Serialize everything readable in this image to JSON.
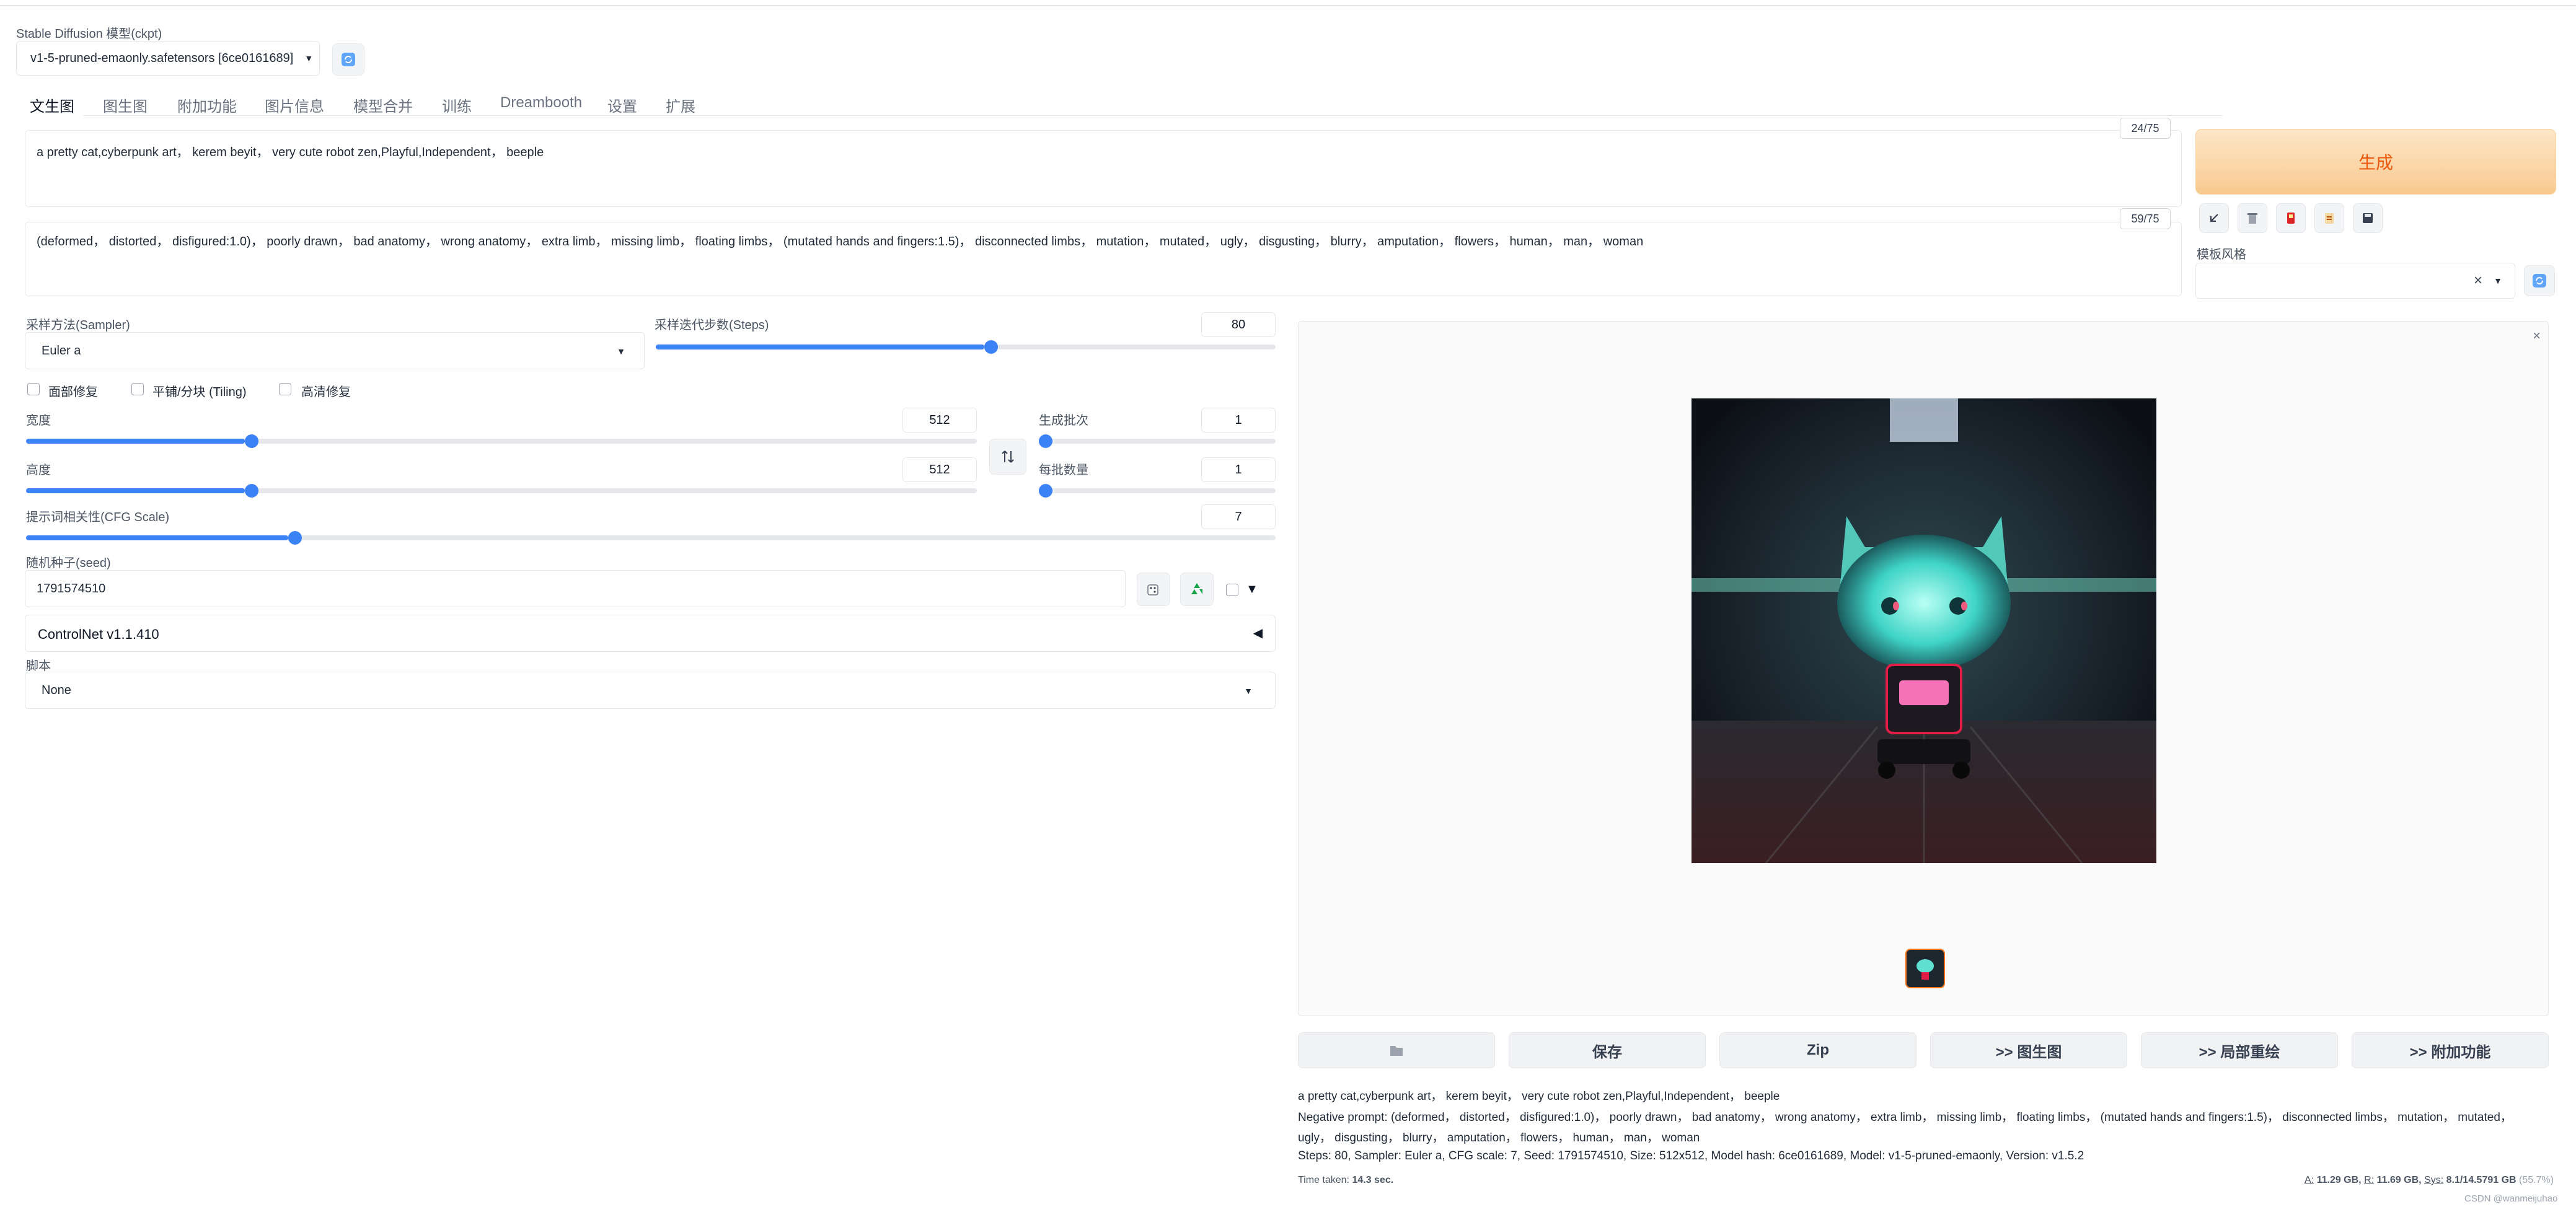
{
  "model": {
    "label": "Stable Diffusion 模型(ckpt)",
    "selected": "v1-5-pruned-emaonly.safetensors [6ce0161689]"
  },
  "tabs": [
    {
      "label": "文生图",
      "active": true
    },
    {
      "label": "图生图"
    },
    {
      "label": "附加功能"
    },
    {
      "label": "图片信息"
    },
    {
      "label": "模型合并"
    },
    {
      "label": "训练"
    },
    {
      "label": "Dreambooth"
    },
    {
      "label": "设置"
    },
    {
      "label": "扩展"
    }
  ],
  "prompt": {
    "value": "a pretty cat,cyberpunk art， kerem beyit， very cute robot zen,Playful,Independent， beeple",
    "counter": "24/75"
  },
  "negative_prompt": {
    "value": "(deformed， distorted， disfigured:1.0)， poorly drawn， bad anatomy， wrong anatomy， extra limb， missing limb， floating limbs， (mutated hands and fingers:1.5)， disconnected limbs， mutation， mutated， ugly， disgusting， blurry， amputation， flowers， human， man， woman",
    "counter": "59/75"
  },
  "generate_label": "生成",
  "style": {
    "label": "模板风格",
    "clear": "×"
  },
  "sampler": {
    "label": "采样方法(Sampler)",
    "value": "Euler a"
  },
  "steps": {
    "label": "采样迭代步数(Steps)",
    "value": "80",
    "fraction": 0.53
  },
  "checkboxes": [
    "面部修复",
    "平铺/分块 (Tiling)",
    "高清修复"
  ],
  "width": {
    "label": "宽度",
    "value": "512",
    "fraction": 0.23
  },
  "height": {
    "label": "高度",
    "value": "512",
    "fraction": 0.23
  },
  "batch_count": {
    "label": "生成批次",
    "value": "1",
    "fraction": 0.0
  },
  "batch_size": {
    "label": "每批数量",
    "value": "1",
    "fraction": 0.0
  },
  "cfg": {
    "label": "提示词相关性(CFG Scale)",
    "value": "7",
    "fraction": 0.21
  },
  "seed": {
    "label": "随机种子(seed)",
    "value": "1791574510",
    "extra": "▼"
  },
  "controlnet": {
    "label": "ControlNet v1.1.410",
    "arrow": "◀"
  },
  "script": {
    "label": "脚本",
    "value": "None"
  },
  "output_buttons": {
    "save": "保存",
    "zip": "Zip",
    "to_img2img": ">> 图生图",
    "to_inpaint": ">> 局部重绘",
    "to_extras": ">> 附加功能"
  },
  "gen_info": {
    "prompt": "a pretty cat,cyberpunk art， kerem beyit， very cute robot zen,Playful,Independent， beeple",
    "negative_1": "Negative prompt: (deformed， distorted， disfigured:1.0)， poorly drawn， bad anatomy， wrong anatomy， extra limb， missing limb， floating limbs， (mutated hands and fingers:1.5)， disconnected limbs， mutation， mutated，",
    "negative_2": "ugly， disgusting， blurry， amputation， flowers， human， man， woman",
    "params": "Steps: 80, Sampler: Euler a, CFG scale: 7, Seed: 1791574510, Size: 512x512, Model hash: 6ce0161689, Model: v1-5-pruned-emaonly, Version: v1.5.2"
  },
  "time_taken": {
    "label": "Time taken:",
    "value": "14.3 sec."
  },
  "memory": {
    "a_label": "A:",
    "a_value": "11.29 GB,",
    "r_label": "R:",
    "r_value": "11.69 GB,",
    "sys_label": "Sys:",
    "sys_value": "8.1/14.5791 GB",
    "percent": "(55.7%)"
  },
  "watermark": "CSDN @wanmeijuhao",
  "colors": {
    "accent": "#3b82f6",
    "generate_text": "#ea580c"
  }
}
